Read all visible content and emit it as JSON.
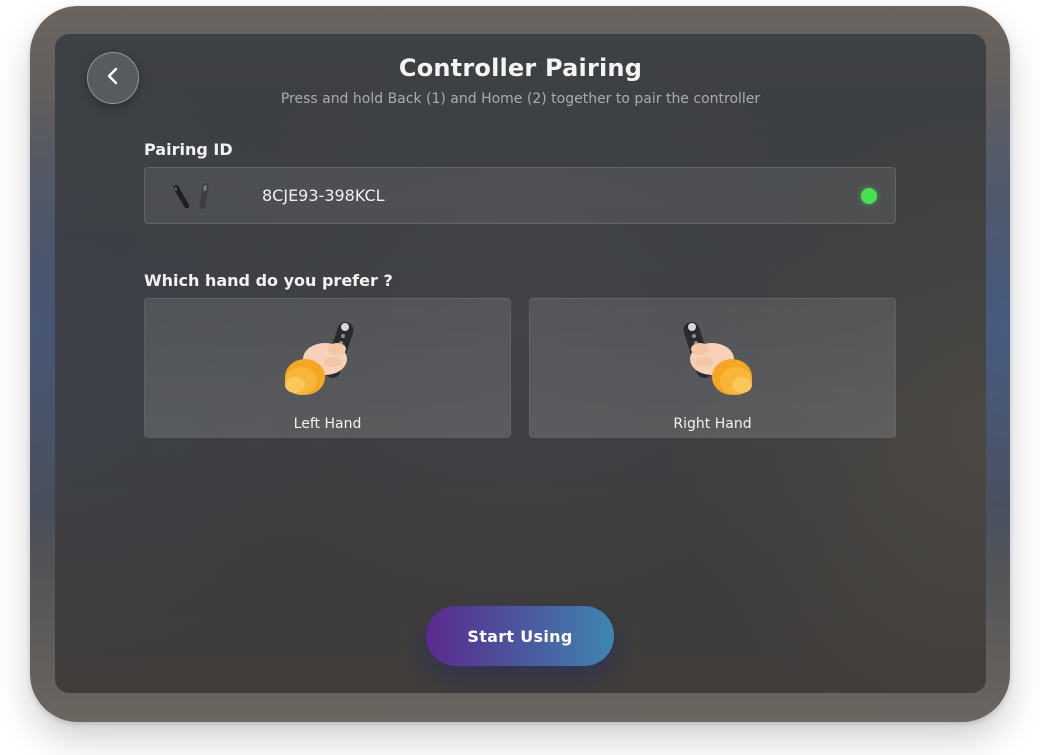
{
  "header": {
    "title": "Controller Pairing",
    "subtitle": "Press and hold Back (1) and Home (2) together to pair the controller"
  },
  "back_button": {
    "icon": "chevron-left-icon"
  },
  "pairing": {
    "label": "Pairing ID",
    "value": "8CJE93-398KCL",
    "icon": "vr-controllers-icon",
    "status": "connected",
    "status_color": "#47e052"
  },
  "hand_preference": {
    "question": "Which hand do you prefer ?",
    "options": [
      {
        "label": "Left Hand",
        "icon": "left-hand-controller-icon"
      },
      {
        "label": "Right Hand",
        "icon": "right-hand-controller-icon"
      }
    ]
  },
  "start_button": {
    "label": "Start Using"
  },
  "colors": {
    "accent_gradient_start": "#5a2a8e",
    "accent_gradient_end": "#3f86b0",
    "status_green": "#47e052",
    "sleeve_yellow": "#f5a623"
  }
}
